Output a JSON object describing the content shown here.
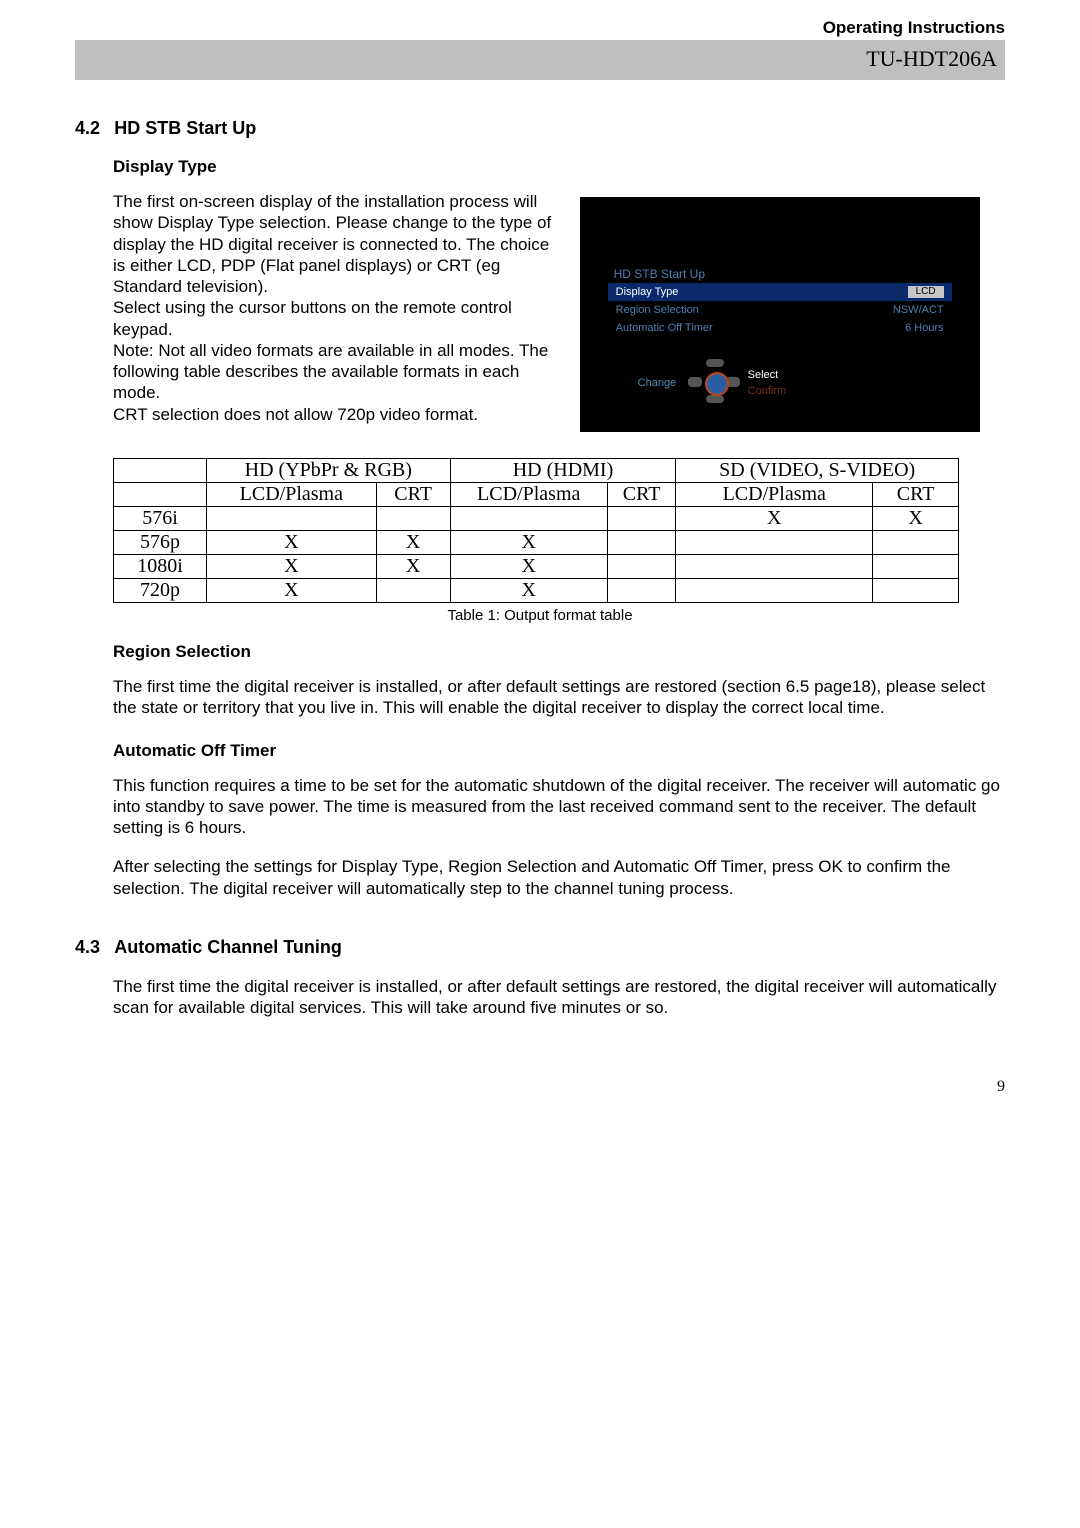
{
  "header": {
    "top": "Operating Instructions",
    "model": "TU-HDT206A"
  },
  "s42": {
    "num": "4.2",
    "title": "HD STB Start Up",
    "display_type_head": "Display Type",
    "p1": "The first on-screen display of the installation process will show Display Type selection. Please change to the type of display the HD digital receiver is connected to. The choice is either LCD, PDP (Flat panel displays) or CRT (eg Standard television).",
    "p2": "Select using the cursor buttons on the remote control keypad.",
    "p3": "Note: Not all video formats are available in all modes.  The following table describes the available formats in each mode.",
    "p4": "CRT selection does not allow 720p video format."
  },
  "screen": {
    "title": "HD STB Start Up",
    "rows": [
      {
        "label": "Display Type",
        "value": "LCD",
        "boxed": true,
        "selected": true
      },
      {
        "label": "Region Selection",
        "value": "NSW/ACT",
        "boxed": false,
        "selected": false
      },
      {
        "label": "Automatic Off Timer",
        "value": "6 Hours",
        "boxed": false,
        "selected": false
      }
    ],
    "change": "Change",
    "select": "Select",
    "confirm": "Confirm"
  },
  "table": {
    "caption": "Table 1: Output format table",
    "group_headers": [
      "HD (YPbPr & RGB)",
      "HD (HDMI)",
      "SD (VIDEO, S-VIDEO)"
    ],
    "sub_headers": [
      "LCD/Plasma",
      "CRT",
      "LCD/Plasma",
      "CRT",
      "LCD/Plasma",
      "CRT"
    ],
    "rows": [
      {
        "label": "576i",
        "cells": [
          "",
          "",
          "",
          "",
          "X",
          "X"
        ]
      },
      {
        "label": "576p",
        "cells": [
          "X",
          "X",
          "X",
          "",
          "",
          ""
        ]
      },
      {
        "label": "1080i",
        "cells": [
          "X",
          "X",
          "X",
          "",
          "",
          ""
        ]
      },
      {
        "label": "720p",
        "cells": [
          "X",
          "",
          "X",
          "",
          "",
          ""
        ]
      }
    ]
  },
  "region": {
    "head": "Region Selection",
    "body": "The first time the digital receiver is installed, or after default settings are restored (section 6.5 page18), please select the state or territory that you live in. This will enable the digital receiver to display the correct local time."
  },
  "aot": {
    "head": "Automatic Off Timer",
    "p1": "This function requires a time to be set for the automatic shutdown of the digital receiver. The receiver will automatic go into standby to save power. The time is measured from the last received command sent to the receiver.  The default setting is 6 hours.",
    "p2": "After selecting the settings for Display Type, Region Selection and Automatic Off Timer, press OK to confirm the selection. The digital receiver will automatically step to the channel tuning process."
  },
  "s43": {
    "num": "4.3",
    "title": "Automatic Channel Tuning",
    "body": "The first time the digital receiver is installed, or after default settings are restored, the digital receiver will automatically scan for available digital services.  This will take around five minutes or so."
  },
  "page_number": "9"
}
